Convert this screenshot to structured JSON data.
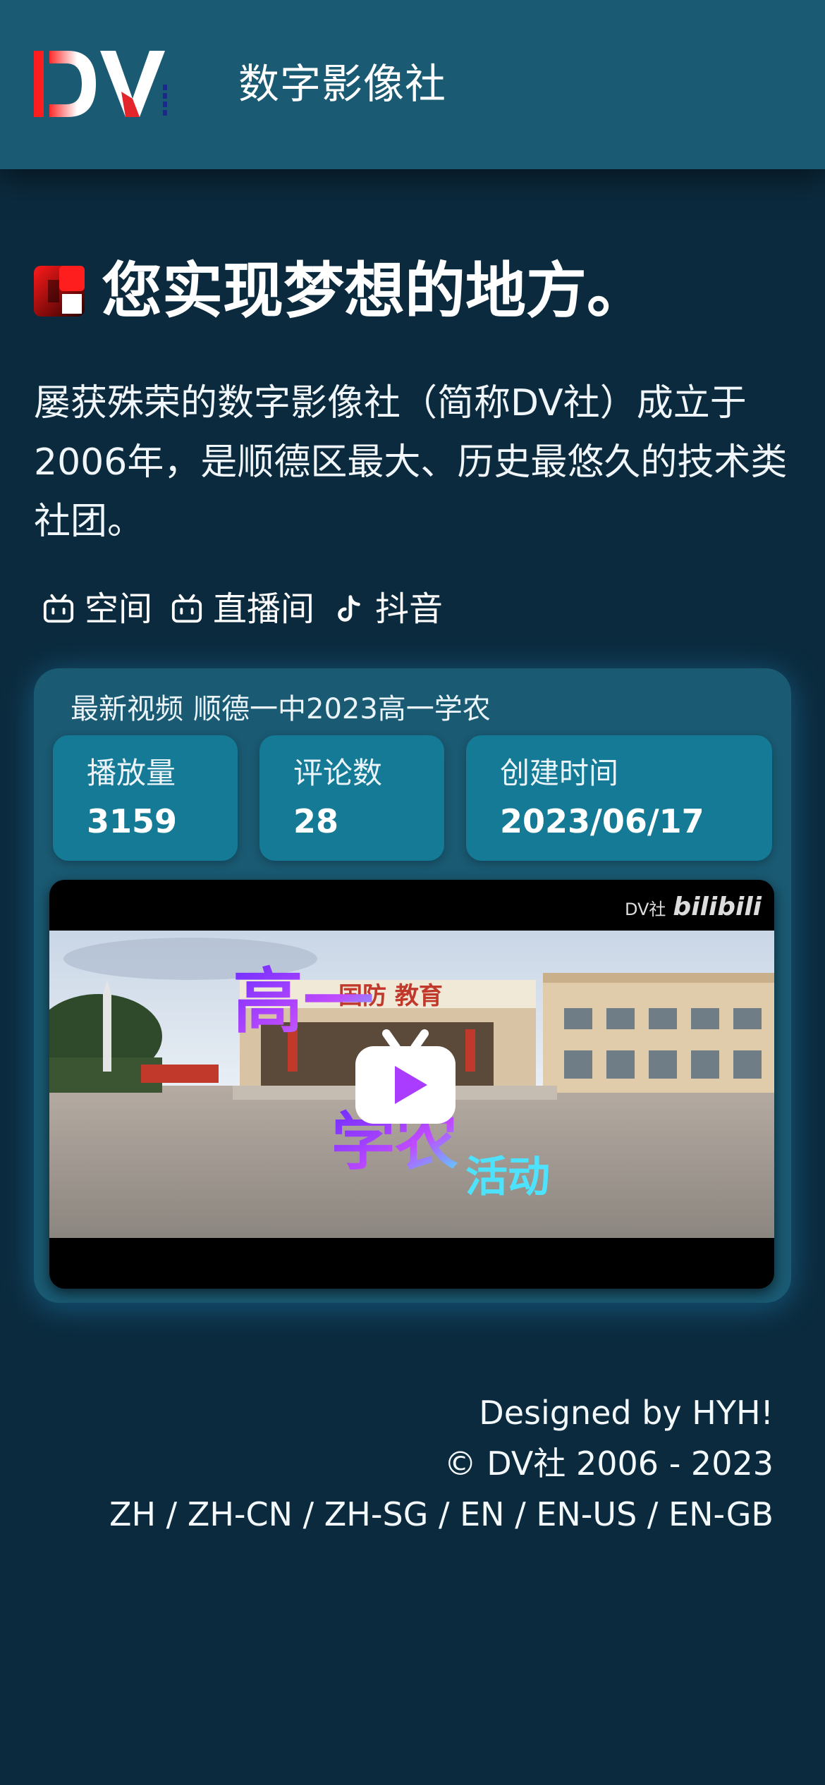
{
  "header": {
    "logo_text": "DV",
    "site_title": "数字影像社"
  },
  "hero": {
    "title": "您实现梦想的地方。",
    "intro": "屡获殊荣的数字影像社（简称DV社）成立于2006年，是顺德区最大、历史最悠久的技术类社团。"
  },
  "links": [
    {
      "label": "空间",
      "icon": "bilibili-icon"
    },
    {
      "label": "直播间",
      "icon": "bilibili-icon"
    },
    {
      "label": "抖音",
      "icon": "tiktok-icon"
    }
  ],
  "video_card": {
    "heading_prefix": "最新视频",
    "video_title": "顺德一中2023高一学农",
    "stats": [
      {
        "label": "播放量",
        "value": "3159"
      },
      {
        "label": "评论数",
        "value": "28"
      },
      {
        "label": "创建时间",
        "value": "2023/06/17"
      }
    ],
    "thumbnail": {
      "watermark_club": "DV社",
      "watermark_brand": "bilibili",
      "sign_text": "国防 教育",
      "overlay_text": [
        "高一",
        "学农",
        "活动"
      ]
    }
  },
  "footer": {
    "designed_by": "Designed by HYH!",
    "copyright": "© DV社 2006 - 2023",
    "languages": [
      "ZH",
      "ZH-CN",
      "ZH-SG",
      "EN",
      "EN-US",
      "EN-GB"
    ],
    "lang_separator": " / "
  },
  "colors": {
    "background": "#0b2a3d",
    "header": "#1a5a73",
    "card": "#1a5a73",
    "stat": "#147a96",
    "logo_red": "#e3262c"
  }
}
